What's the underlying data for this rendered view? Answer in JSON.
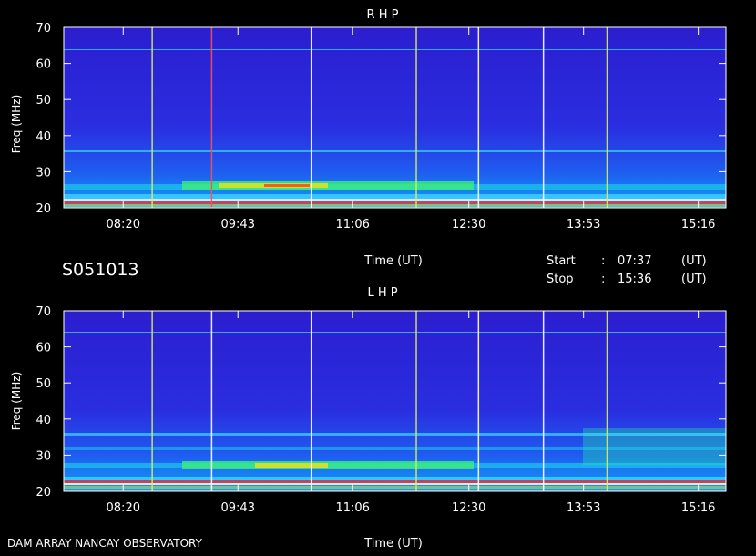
{
  "chart_data": [
    {
      "type": "heatmap",
      "title": "R H P",
      "xlabel": "Time (UT)",
      "ylabel": "Freq (MHz)",
      "xlim": [
        "07:37",
        "15:36"
      ],
      "ylim": [
        20,
        70
      ],
      "x_ticks": [
        "08:20",
        "09:43",
        "11:06",
        "12:30",
        "13:53",
        "15:16"
      ],
      "y_ticks": [
        20,
        30,
        40,
        50,
        60,
        70
      ],
      "vertical_markers": [
        {
          "time": "08:41",
          "color": "#d8f060"
        },
        {
          "time": "09:24",
          "color": "#ff5050"
        },
        {
          "time": "10:36",
          "color": "#ffffff"
        },
        {
          "time": "11:52",
          "color": "#d8f060"
        },
        {
          "time": "12:37",
          "color": "#ffffff"
        },
        {
          "time": "13:24",
          "color": "#ffffff"
        },
        {
          "time": "14:10",
          "color": "#d8f060"
        }
      ],
      "intensity_note": "low intensity (blue) to high intensity (red/white), strongest below 30 MHz"
    },
    {
      "type": "heatmap",
      "title": "L H P",
      "xlabel": "Time (UT)",
      "ylabel": "Freq (MHz)",
      "xlim": [
        "07:37",
        "15:36"
      ],
      "ylim": [
        20,
        70
      ],
      "x_ticks": [
        "08:20",
        "09:43",
        "11:06",
        "12:30",
        "13:53",
        "15:16"
      ],
      "y_ticks": [
        20,
        30,
        40,
        50,
        60,
        70
      ],
      "vertical_markers": [
        {
          "time": "08:41",
          "color": "#d8f060"
        },
        {
          "time": "09:24",
          "color": "#ffffff"
        },
        {
          "time": "10:36",
          "color": "#ffffff"
        },
        {
          "time": "11:52",
          "color": "#d8f060"
        },
        {
          "time": "12:37",
          "color": "#ffffff"
        },
        {
          "time": "13:24",
          "color": "#ffffff"
        },
        {
          "time": "14:10",
          "color": "#d8f060"
        }
      ],
      "intensity_note": "low intensity (blue) to high intensity (red/white), strongest below 30 MHz"
    }
  ],
  "header": {
    "obs_id": "S051013",
    "start_label": "Start",
    "start_time": "07:37",
    "stop_label": "Stop",
    "stop_time": "15:36",
    "colon": ":",
    "ut_tag": "(UT)"
  },
  "footer": {
    "observatory": "DAM ARRAY  NANCAY OBSERVATORY"
  },
  "colors": {
    "background": "#000000",
    "panel_fill": "#2a22dc",
    "frame": "#ffffff",
    "marker_yellow": "#d8f060",
    "marker_red": "#ff5050"
  }
}
